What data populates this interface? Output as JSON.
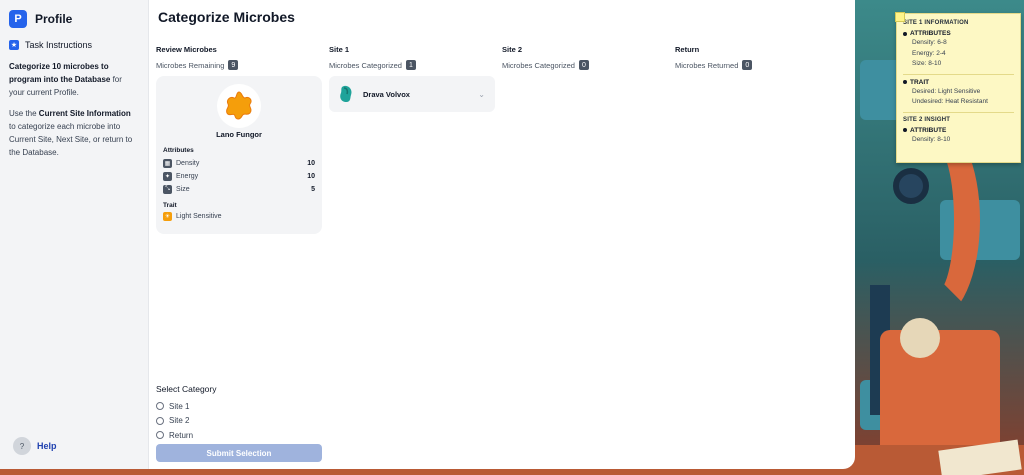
{
  "sidebar": {
    "brand_letter": "P",
    "title": "Profile",
    "task_label": "Task Instructions",
    "instruction_1_bold": "Categorize 10 microbes to program into the Database",
    "instruction_1_rest": " for your current Profile.",
    "instruction_2_pre": "Use the ",
    "instruction_2_bold": "Current Site Information",
    "instruction_2_rest": " to categorize each microbe into Current Site, Next Site, or return to the Database.",
    "help_label": "Help"
  },
  "main": {
    "title": "Categorize Microbes",
    "columns": [
      {
        "title": "Review Microbes",
        "sub_label": "Microbes Remaining",
        "count": "9"
      },
      {
        "title": "Site 1",
        "sub_label": "Microbes Categorized",
        "count": "1"
      },
      {
        "title": "Site 2",
        "sub_label": "Microbes Categorized",
        "count": "0"
      },
      {
        "title": "Return",
        "sub_label": "Microbes Returned",
        "count": "0"
      }
    ],
    "card": {
      "name": "Lano Fungor",
      "attributes_label": "Attributes",
      "attributes": [
        {
          "label": "Density",
          "value": "10"
        },
        {
          "label": "Energy",
          "value": "10"
        },
        {
          "label": "Size",
          "value": "5"
        }
      ],
      "trait_label": "Trait",
      "trait": "Light Sensitive"
    },
    "site1_item": {
      "name": "Drava Volvox"
    },
    "select": {
      "title": "Select Category",
      "options": [
        "Site 1",
        "Site 2",
        "Return"
      ]
    },
    "submit_label": "Submit Selection"
  },
  "note": {
    "site1_header": "SITE 1 INFORMATION",
    "attribute_header": "ATTRIBUTES",
    "attributes": [
      "Density: 6-8",
      "Energy: 2-4",
      "Size: 8-10"
    ],
    "trait_header": "TRAIT",
    "desired_label": "Desired:",
    "desired_value": " Light Sensitive",
    "undesired_label": "Undesired:",
    "undesired_value": " Heat Resistant",
    "site2_header": "SITE 2 INSIGHT",
    "insight_header": "ATTRIBUTE",
    "insight_line": "Density: 8-10"
  },
  "colors": {
    "accent": "#2563eb",
    "blob": "#f59e0b",
    "trait": "#f59e0b",
    "submit_disabled": "#9fb3dd"
  }
}
